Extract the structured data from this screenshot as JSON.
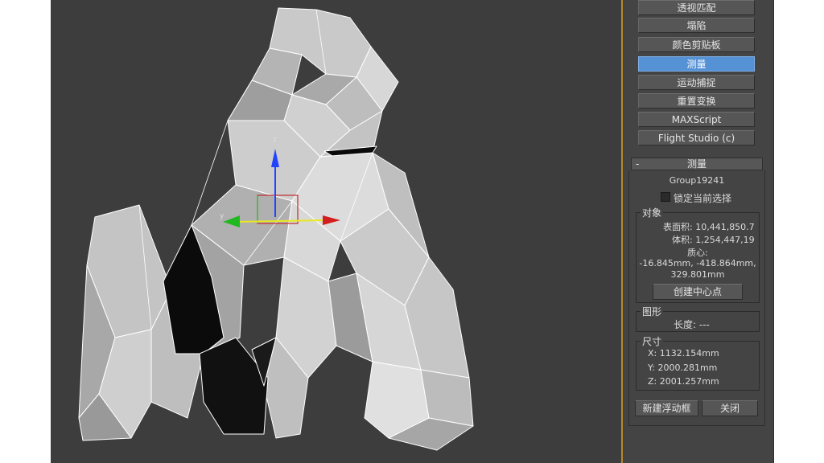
{
  "colors": {
    "viewport_bg": "#3d3d3d",
    "panel_bg": "#444444",
    "active_button": "#5591d5",
    "accent_divider": "#b8882b"
  },
  "utilities": [
    {
      "label": "透视匹配",
      "active": false
    },
    {
      "label": "塌陷",
      "active": false
    },
    {
      "label": "颜色剪贴板",
      "active": false
    },
    {
      "label": "测量",
      "active": true
    },
    {
      "label": "运动捕捉",
      "active": false
    },
    {
      "label": "重置变换",
      "active": false
    },
    {
      "label": "MAXScript",
      "active": false
    },
    {
      "label": "Flight Studio (c)",
      "active": false
    }
  ],
  "measure": {
    "collapse_symbol": "-",
    "title": "测量",
    "object_name": "Group19241",
    "lock_selection_label": "锁定当前选择",
    "lock_selection_checked": false,
    "object_group_label": "对象",
    "surface_area": "表面积: 10,441,850.7",
    "volume": "体积: 1,254,447,19",
    "center_label": "质心:",
    "center_line1": "-16.845mm, -418.864mm,",
    "center_line2": "329.801mm",
    "create_center_button": "创建中心点",
    "shape_group_label": "图形",
    "length": "长度: ---",
    "dimensions_group_label": "尺寸",
    "dim_x": "X:  1132.154mm",
    "dim_y": "Y:  2000.281mm",
    "dim_z": "Z:  2001.257mm",
    "new_float_button": "新建浮动框",
    "close_button": "关闭"
  },
  "gizmo": {
    "x_label": "x",
    "y_label": "y",
    "z_label": "z"
  }
}
